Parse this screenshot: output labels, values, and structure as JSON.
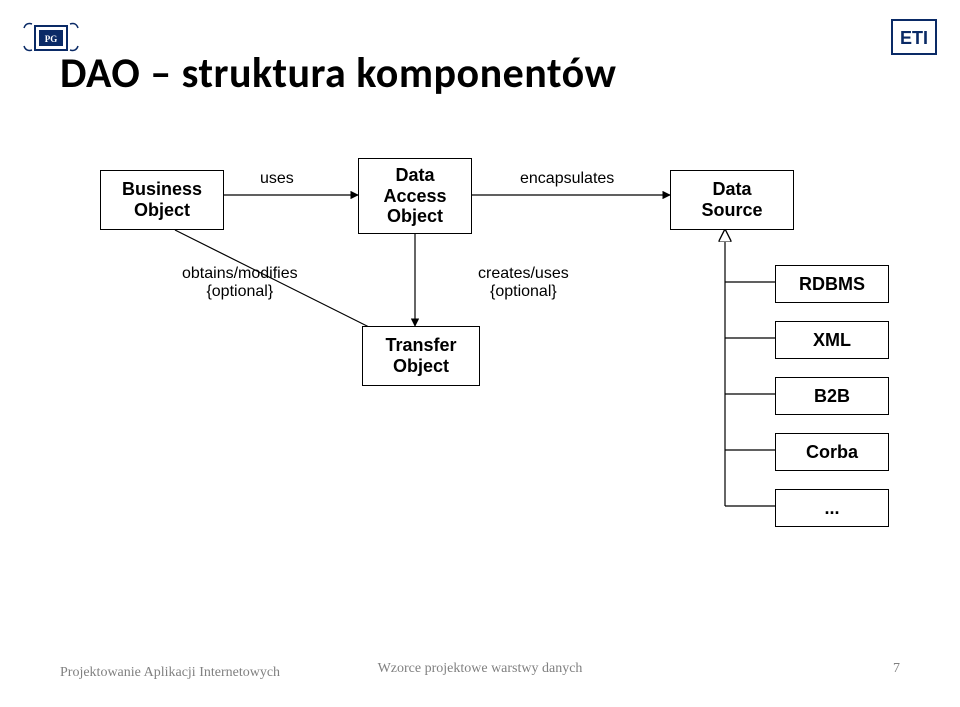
{
  "title": "DAO – struktura komponentów",
  "boxes": {
    "business_object": "Business\nObject",
    "dao": "Data\nAccess\nObject",
    "data_source": "Data\nSource",
    "transfer_object": "Transfer\nObject",
    "rdbms": "RDBMS",
    "xml": "XML",
    "b2b": "B2B",
    "corba": "Corba",
    "ellipsis": "..."
  },
  "labels": {
    "uses": "uses",
    "encapsulates": "encapsulates",
    "obtains_modifies": "obtains/modifies\n{optional}",
    "creates_uses": "creates/uses\n{optional}"
  },
  "footer": {
    "left": "Projektowanie Aplikacji\nInternetowych",
    "center": "Wzorce projektowe warstwy danych",
    "page": "7"
  }
}
